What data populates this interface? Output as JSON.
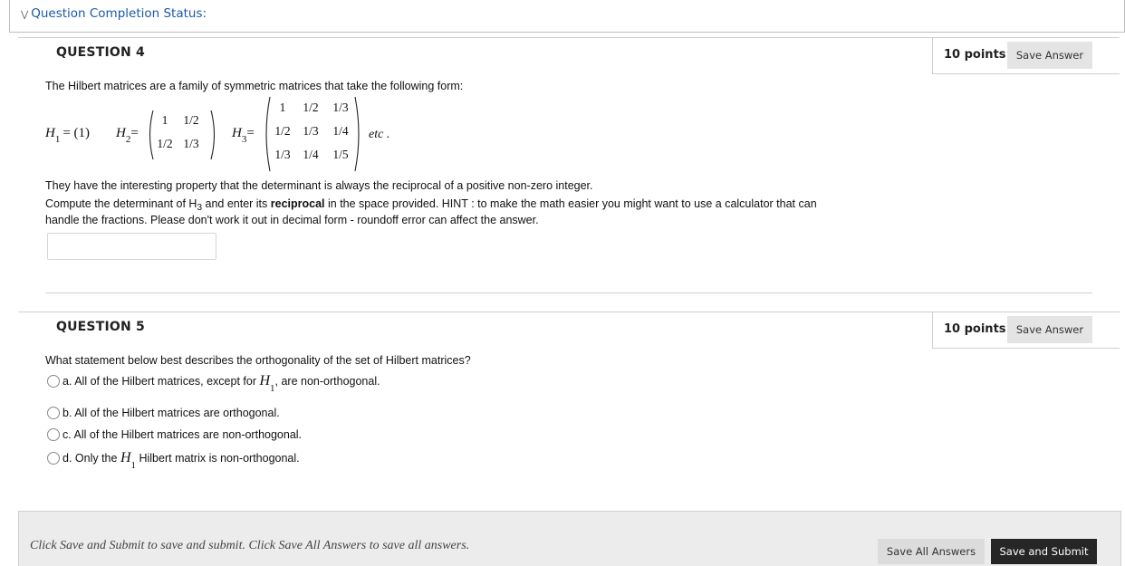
{
  "status": {
    "label": "Question Completion Status:"
  },
  "question4": {
    "title": "QUESTION 4",
    "points": "10 points",
    "save_label": "Save Answer",
    "intro": "The Hilbert matrices are a family of symmetric matrices that take the following form:",
    "h1_symbol": "H",
    "h1_subscript": "1",
    "h1_equals": "= (1)",
    "h2_symbol": "H",
    "h2_subscript": "2",
    "h2_equals": "=",
    "h2_cells": [
      "1",
      "1/2",
      "1/2",
      "1/3"
    ],
    "h3_symbol": "H",
    "h3_subscript": "3",
    "h3_equals": "=",
    "h3_cells": [
      "1",
      "1/2",
      "1/3",
      "1/2",
      "1/3",
      "1/4",
      "1/3",
      "1/4",
      "1/5"
    ],
    "etc": "etc .",
    "property_text": "They have the interesting property that the determinant is always the reciprocal of a positive non-zero integer.",
    "instruction_before": "Compute the determinant of H",
    "instruction_sub": "3",
    "instruction_middle": " and enter its ",
    "instruction_bold": "reciprocal",
    "instruction_after": " in the space provided. HINT : to make the math easier you might want to use a calculator that can",
    "instruction_line2": "handle the fractions. Please don't work it out in decimal form - roundoff error can affect the answer.",
    "answer_value": ""
  },
  "question5": {
    "title": "QUESTION 5",
    "points": "10 points",
    "save_label": "Save Answer",
    "prompt": "What statement below best describes the orthogonality of the set of Hilbert matrices?",
    "options": [
      {
        "letter": "a.",
        "before": " All of the Hilbert matrices, except for ",
        "math": "H",
        "sub": "1",
        "after": ", are non-orthogonal."
      },
      {
        "letter": "b.",
        "text": " All of the Hilbert matrices are orthogonal."
      },
      {
        "letter": "c.",
        "text": " All of the Hilbert matrices are non-orthogonal."
      },
      {
        "letter": "d.",
        "before": " Only the ",
        "math": "H",
        "sub": "1",
        "after": " Hilbert matrix is non-orthogonal."
      }
    ]
  },
  "footer": {
    "hint": "Click Save and Submit to save and submit. Click Save All Answers to save all answers.",
    "save_all_label": "Save All Answers",
    "submit_label": "Save and Submit"
  }
}
